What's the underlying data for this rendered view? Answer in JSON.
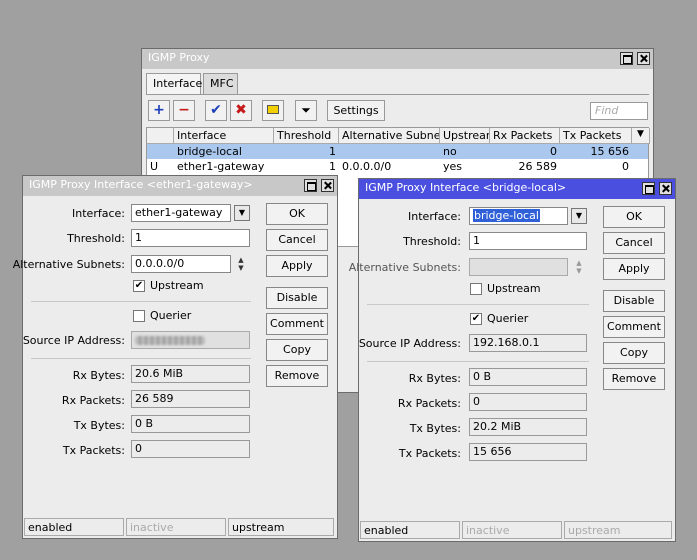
{
  "main_window": {
    "title": "IGMP Proxy",
    "tabs": [
      {
        "label": "Interface"
      },
      {
        "label": "MFC"
      }
    ],
    "toolbar": {
      "add_icon": "plus-icon",
      "remove_icon": "minus-icon",
      "enable_icon": "check-icon",
      "disable_icon": "x-icon",
      "comment_icon": "note-icon",
      "filter_icon": "filter-icon",
      "settings_label": "Settings",
      "find_placeholder": "Find"
    },
    "table": {
      "columns": [
        "Interface",
        "Threshold",
        "Alternative Subnets",
        "Upstream",
        "Rx Packets",
        "Tx Packets"
      ],
      "rows": [
        {
          "flag": "",
          "interface": "bridge-local",
          "threshold": "1",
          "alt_subnets": "",
          "upstream": "no",
          "rx_packets": "0",
          "tx_packets": "15 656"
        },
        {
          "flag": "U",
          "interface": "ether1-gateway",
          "threshold": "1",
          "alt_subnets": "0.0.0.0/0",
          "upstream": "yes",
          "rx_packets": "26 589",
          "tx_packets": "0"
        }
      ]
    }
  },
  "dialog_gateway": {
    "title": "IGMP Proxy Interface <ether1-gateway>",
    "labels": {
      "interface": "Interface:",
      "threshold": "Threshold:",
      "alt_subnets": "Alternative Subnets:",
      "upstream": "Upstream",
      "querier": "Querier",
      "source_ip": "Source IP Address:",
      "rx_bytes": "Rx Bytes:",
      "rx_packets": "Rx Packets:",
      "tx_bytes": "Tx Bytes:",
      "tx_packets": "Tx Packets:"
    },
    "values": {
      "interface": "ether1-gateway",
      "threshold": "1",
      "alt_subnets": "0.0.0.0/0",
      "upstream_checked": true,
      "querier_checked": false,
      "source_ip": "",
      "rx_bytes": "20.6 MiB",
      "rx_packets": "26 589",
      "tx_bytes": "0 B",
      "tx_packets": "0"
    },
    "buttons": [
      "OK",
      "Cancel",
      "Apply",
      "Disable",
      "Comment",
      "Copy",
      "Remove"
    ],
    "status": [
      "enabled",
      "inactive",
      "upstream"
    ]
  },
  "dialog_bridge": {
    "title": "IGMP Proxy Interface <bridge-local>",
    "labels": {
      "interface": "Interface:",
      "threshold": "Threshold:",
      "alt_subnets": "Alternative Subnets:",
      "upstream": "Upstream",
      "querier": "Querier",
      "source_ip": "Source IP Address:",
      "rx_bytes": "Rx Bytes:",
      "rx_packets": "Rx Packets:",
      "tx_bytes": "Tx Bytes:",
      "tx_packets": "Tx Packets:"
    },
    "values": {
      "interface": "bridge-local",
      "threshold": "1",
      "alt_subnets": "",
      "upstream_checked": false,
      "querier_checked": true,
      "source_ip": "192.168.0.1",
      "rx_bytes": "0 B",
      "rx_packets": "0",
      "tx_bytes": "20.2 MiB",
      "tx_packets": "15 656"
    },
    "buttons": [
      "OK",
      "Cancel",
      "Apply",
      "Disable",
      "Comment",
      "Copy",
      "Remove"
    ],
    "status": [
      "enabled",
      "inactive",
      "upstream"
    ]
  },
  "colors": {
    "active_title": "#4a4fe0",
    "selected_row": "#aac8ee",
    "desktop": "#a0a0a0"
  }
}
